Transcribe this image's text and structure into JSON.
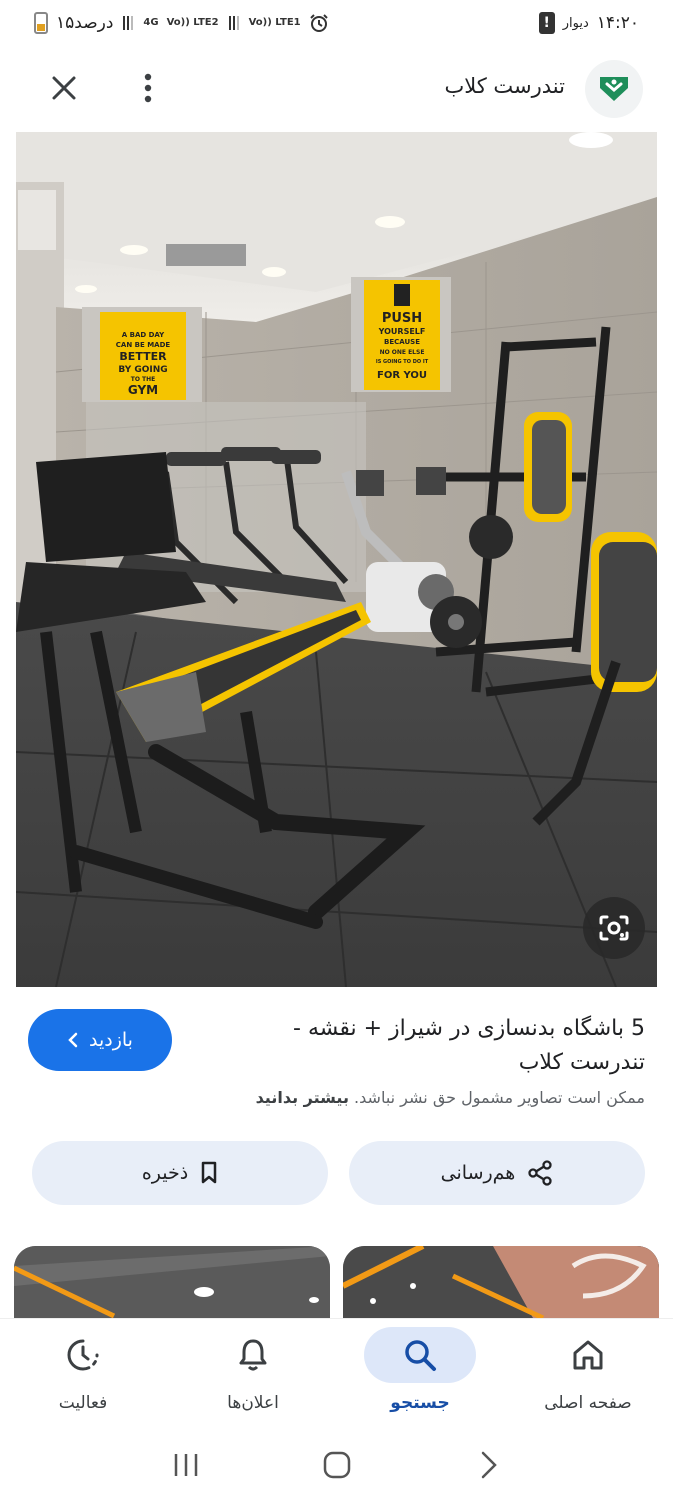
{
  "status_bar": {
    "battery_text": "۱۵درصد",
    "network_1": "4G",
    "network_2": "Vo)) LTE2",
    "network_3": "Vo)) LTE1",
    "carrier": "دیوار",
    "time": "۱۴:۲۰"
  },
  "header": {
    "site_name": "تندرست کلاب",
    "brand_color": "#1e8e5a"
  },
  "result": {
    "title": "5 باشگاه بدنسازی در شیراز + نقشه - تندرست کلاب",
    "visit_label": "بازدید",
    "copyright_text": "ممکن است تصاویر مشمول حق نشر نباشد.",
    "learn_more": "بیشتر بدانید"
  },
  "image": {
    "poster_left_lines": [
      "A BAD DAY",
      "CAN BE MADE",
      "BETTER",
      "BY GOING",
      "TO THE",
      "GYM"
    ],
    "poster_right_lines": [
      "PUSH",
      "YOURSELF",
      "BECAUSE",
      "NO ONE ELSE",
      "IS GOING TO DO IT",
      "FOR YOU"
    ]
  },
  "actions": {
    "save_label": "ذخیره",
    "share_label": "هم‌رسانی"
  },
  "bottom_nav": {
    "items": [
      {
        "label": "فعالیت",
        "icon": "activity-icon"
      },
      {
        "label": "اعلان‌ها",
        "icon": "bell-icon"
      },
      {
        "label": "جستجو",
        "icon": "search-icon",
        "active": true
      },
      {
        "label": "صفحه اصلی",
        "icon": "home-icon"
      }
    ]
  },
  "colors": {
    "accent": "#1a73e8",
    "pill_bg": "#e8eef8",
    "active_nav_bg": "#dde7f9",
    "equipment_yellow": "#f5c400"
  }
}
